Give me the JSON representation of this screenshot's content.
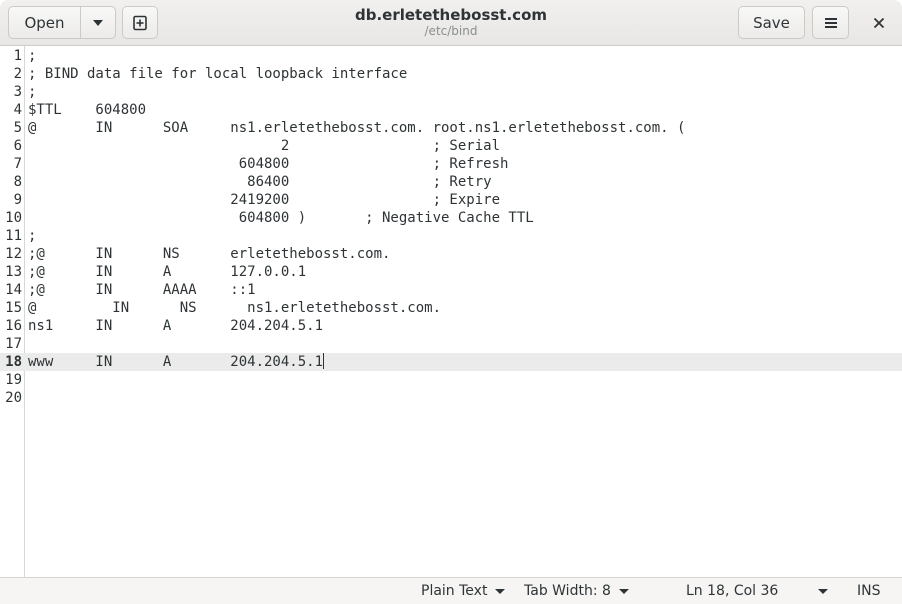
{
  "header": {
    "open_label": "Open",
    "save_label": "Save",
    "title": "db.erletethebosst.com",
    "subtitle": "/etc/bind",
    "close_glyph": "✕",
    "menu_glyph": "☰"
  },
  "editor": {
    "current_line": 18,
    "lines": [
      {
        "n": "1",
        "text": ";"
      },
      {
        "n": "2",
        "text": "; BIND data file for local loopback interface"
      },
      {
        "n": "3",
        "text": ";"
      },
      {
        "n": "4",
        "text": "$TTL    604800"
      },
      {
        "n": "5",
        "text": "@       IN      SOA     ns1.erletethebosst.com. root.ns1.erletethebosst.com. ("
      },
      {
        "n": "6",
        "text": "                              2                 ; Serial"
      },
      {
        "n": "7",
        "text": "                         604800                 ; Refresh"
      },
      {
        "n": "8",
        "text": "                          86400                 ; Retry"
      },
      {
        "n": "9",
        "text": "                        2419200                 ; Expire"
      },
      {
        "n": "10",
        "text": "                         604800 )       ; Negative Cache TTL"
      },
      {
        "n": "11",
        "text": ";"
      },
      {
        "n": "12",
        "text": ";@      IN      NS      erletethebosst.com."
      },
      {
        "n": "13",
        "text": ";@      IN      A       127.0.0.1"
      },
      {
        "n": "14",
        "text": ";@      IN      AAAA    ::1"
      },
      {
        "n": "15",
        "text": "@         IN      NS      ns1.erletethebosst.com."
      },
      {
        "n": "16",
        "text": "ns1     IN      A       204.204.5.1"
      },
      {
        "n": "17",
        "text": ""
      },
      {
        "n": "18",
        "text": "www     IN      A       204.204.5.1"
      },
      {
        "n": "19",
        "text": ""
      },
      {
        "n": "20",
        "text": ""
      }
    ]
  },
  "statusbar": {
    "language": "Plain Text",
    "tab_width": "Tab Width: 8",
    "position": "Ln 18, Col 36",
    "mode": "INS"
  }
}
